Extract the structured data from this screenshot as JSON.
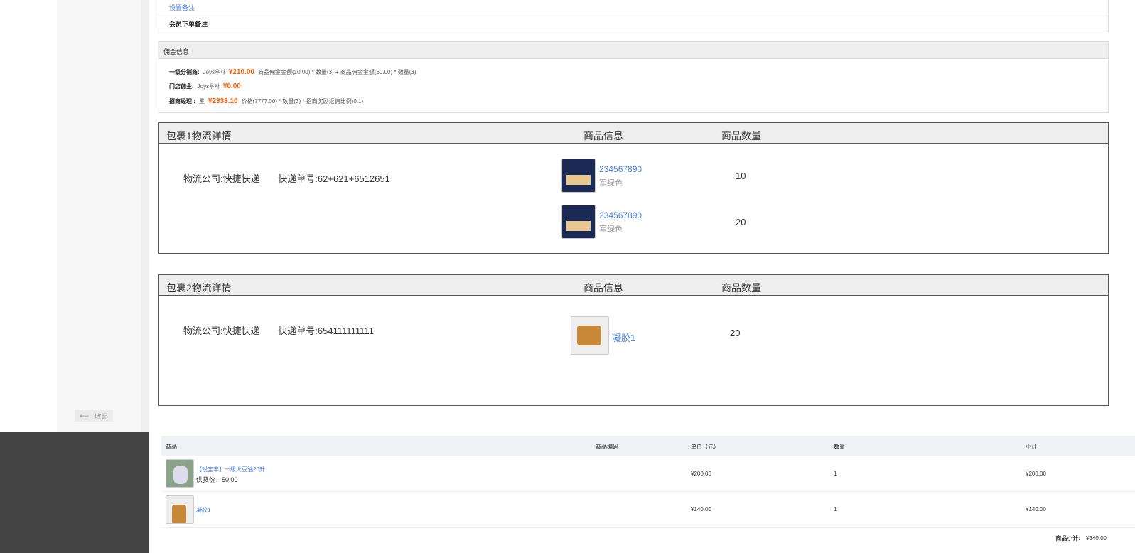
{
  "sidebar": {
    "collapse_label": "收起",
    "collapse_icon": "arrow-left-icon"
  },
  "remarks": {
    "set_remark": "设置备注",
    "member_note_label": "会员下单备注:"
  },
  "commission": {
    "title": "佣金信息",
    "rows": [
      {
        "label": "一级分销商:",
        "name": "Joys우사",
        "amount": "¥210.00",
        "formula": "商品佣金金额(10.00) * 数量(3) + 商品佣金金额(60.00) * 数量(3)"
      },
      {
        "label": "门店佣金:",
        "name": "Joys우사",
        "amount": "¥0.00",
        "formula": ""
      },
      {
        "label": "招商经理 :",
        "name": "星",
        "amount": "¥2333.10",
        "formula": "价格(7777.00) * 数量(3) * 招商奖励返佣比例(0.1)"
      }
    ],
    "accent": "#ff5a00"
  },
  "packages": [
    {
      "title": "包裹1物流详情",
      "col_goods": "商品信息",
      "col_qty": "商品数量",
      "company_label": "物流公司:",
      "company": "快捷快递",
      "tracking_label": "快递单号:",
      "tracking": "62+621+6512651",
      "items": [
        {
          "name": "234567890",
          "spec": "军绿色",
          "qty": "10"
        },
        {
          "name": "234567890",
          "spec": "军绿色",
          "qty": "20"
        }
      ]
    },
    {
      "title": "包裹2物流详情",
      "col_goods": "商品信息",
      "col_qty": "商品数量",
      "company_label": "物流公司:",
      "company": "快捷快递",
      "tracking_label": "快递单号:",
      "tracking": "654111111111",
      "items": [
        {
          "name": "凝胶1",
          "spec": "",
          "qty": "20"
        }
      ]
    }
  ],
  "goods_table": {
    "headers": [
      "商品",
      "商品编码",
      "单价（元）",
      "数量",
      "小计"
    ],
    "rows": [
      {
        "name": "【锐宝丰】一级大豆油20升",
        "supply": "供货价：50.00",
        "code": "",
        "price": "¥200.00",
        "qty": "1",
        "subtotal": "¥200.00"
      },
      {
        "name": "凝胶1",
        "supply": "",
        "code": "",
        "price": "¥140.00",
        "qty": "1",
        "subtotal": "¥140.00"
      }
    ],
    "total_label": "商品小计:",
    "total": "¥340.00"
  }
}
